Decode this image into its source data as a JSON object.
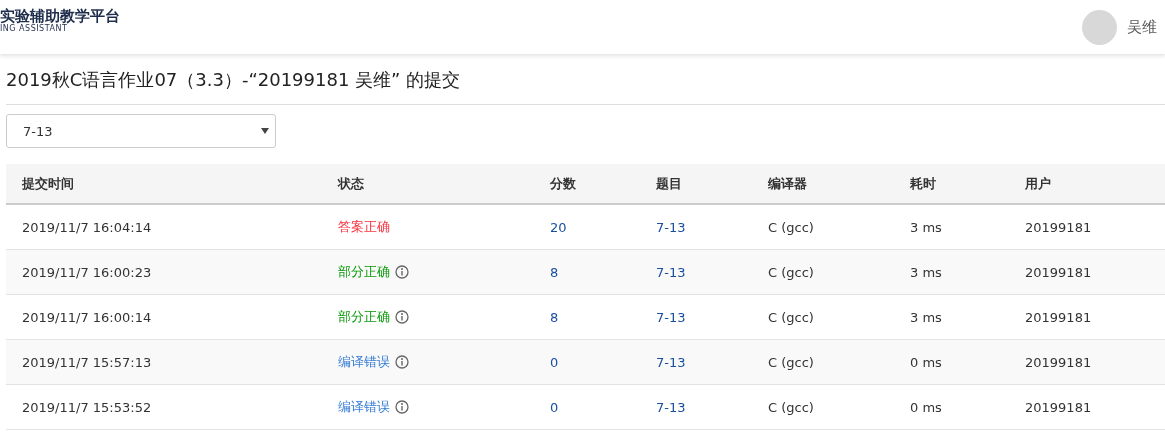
{
  "header": {
    "logo_title": "实验辅助教学平台",
    "logo_subtitle": "ING ASSISTANT",
    "user_name": "吴维"
  },
  "page_title": "2019秋C语言作业07（3.3）-“20199181 吴维” 的提交",
  "problem_select": {
    "value": "7-13"
  },
  "table": {
    "columns": [
      "提交时间",
      "状态",
      "分数",
      "题目",
      "编译器",
      "耗时",
      "用户"
    ],
    "rows": [
      {
        "time": "2019/11/7 16:04:14",
        "status": "答案正确",
        "kind": "accepted",
        "info": false,
        "score": "20",
        "problem": "7-13",
        "compiler": "C (gcc)",
        "duration": "3 ms",
        "user": "20199181"
      },
      {
        "time": "2019/11/7 16:00:23",
        "status": "部分正确",
        "kind": "partial",
        "info": true,
        "score": "8",
        "problem": "7-13",
        "compiler": "C (gcc)",
        "duration": "3 ms",
        "user": "20199181"
      },
      {
        "time": "2019/11/7 16:00:14",
        "status": "部分正确",
        "kind": "partial",
        "info": true,
        "score": "8",
        "problem": "7-13",
        "compiler": "C (gcc)",
        "duration": "3 ms",
        "user": "20199181"
      },
      {
        "time": "2019/11/7 15:57:13",
        "status": "编译错误",
        "kind": "compile_error",
        "info": true,
        "score": "0",
        "problem": "7-13",
        "compiler": "C (gcc)",
        "duration": "0 ms",
        "user": "20199181"
      },
      {
        "time": "2019/11/7 15:53:52",
        "status": "编译错误",
        "kind": "compile_error",
        "info": true,
        "score": "0",
        "problem": "7-13",
        "compiler": "C (gcc)",
        "duration": "0 ms",
        "user": "20199181"
      }
    ]
  }
}
